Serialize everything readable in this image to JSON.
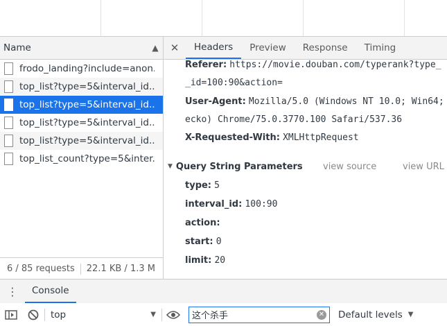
{
  "request_list": {
    "column_header": "Name",
    "sort_icon": "triangle-up-icon",
    "items": [
      {
        "name": "frodo_landing?include=anon..."
      },
      {
        "name": "top_list?type=5&interval_id..."
      },
      {
        "name": "top_list?type=5&interval_id..."
      },
      {
        "name": "top_list?type=5&interval_id..."
      },
      {
        "name": "top_list?type=5&interval_id..."
      },
      {
        "name": "top_list_count?type=5&inter..."
      }
    ],
    "selected_index": 2,
    "summary_requests": "6 / 85 requests",
    "summary_size": "22.1 KB / 1.3 M"
  },
  "detail": {
    "tabs": [
      "Headers",
      "Preview",
      "Response",
      "Timing"
    ],
    "active_tab": "Headers",
    "headers": {
      "referer_label": "Referer:",
      "referer_value": "https://movie.douban.com/typerank?type_",
      "referer_cont": "_id=100:90&action=",
      "ua_label": "User-Agent:",
      "ua_value": "Mozilla/5.0 (Windows NT 10.0; Win64;",
      "ua_cont": "ecko) Chrome/75.0.3770.100 Safari/537.36",
      "xrw_label": "X-Requested-With:",
      "xrw_value": "XMLHttpRequest"
    },
    "query_section": {
      "title": "Query String Parameters",
      "view_source": "view source",
      "view_url": "view URL",
      "params": [
        {
          "key": "type:",
          "value": "5"
        },
        {
          "key": "interval_id:",
          "value": "100:90"
        },
        {
          "key": "action:",
          "value": ""
        },
        {
          "key": "start:",
          "value": "0"
        },
        {
          "key": "limit:",
          "value": "20"
        }
      ]
    }
  },
  "drawer": {
    "tab": "Console",
    "context": "top",
    "filter_value": "这个杀手",
    "levels": "Default levels"
  },
  "colors": {
    "accent": "#1a73e8",
    "selected_row": "#1a73e8"
  }
}
